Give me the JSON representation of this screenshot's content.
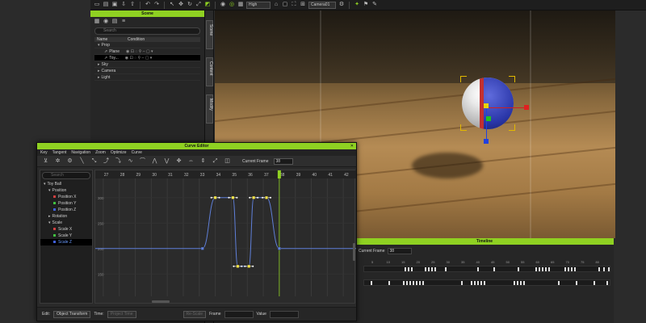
{
  "toolbar": {
    "quality": "High",
    "camera": "Camera01",
    "icons": [
      "new-file-icon",
      "open-folder-icon",
      "save-icon",
      "import-icon",
      "export-icon",
      "undo-icon",
      "redo-icon",
      "select-icon",
      "move-icon",
      "rotate-icon",
      "scale-icon",
      "snap-icon",
      "camera-icon",
      "eye-icon",
      "render-icon",
      "home-icon",
      "view-icon",
      "fullscreen-icon",
      "grid-icon",
      "settings-icon"
    ]
  },
  "scene": {
    "title": "Scene",
    "search_placeholder": "Search",
    "col_name": "Name",
    "col_condition": "Condition",
    "items": [
      {
        "label": "Prop",
        "indent": 0,
        "twisty": "▾"
      },
      {
        "label": "Plane",
        "indent": 1,
        "twisty": ""
      },
      {
        "label": "Toy...",
        "indent": 1,
        "twisty": "",
        "selected": true
      },
      {
        "label": "Sky",
        "indent": 0,
        "twisty": "▸"
      },
      {
        "label": "Camera",
        "indent": 0,
        "twisty": "▸"
      },
      {
        "label": "Light",
        "indent": 0,
        "twisty": "▸"
      }
    ],
    "side_tabs": [
      "Scene",
      "Content",
      "Modify"
    ]
  },
  "curve_editor": {
    "title": "Curve Editor",
    "menu": [
      "Key",
      "Tangent",
      "Navigation",
      "Zoom",
      "Optimize",
      "Curve"
    ],
    "current_frame_label": "Current Frame",
    "current_frame": "38",
    "search_placeholder": "Search",
    "tree": [
      {
        "label": "Toy Ball",
        "level": 0,
        "twisty": "▾"
      },
      {
        "label": "Position",
        "level": 1,
        "twisty": "▾"
      },
      {
        "label": "Position X",
        "level": 2,
        "color": "#d04040"
      },
      {
        "label": "Position Y",
        "level": 2,
        "color": "#40c040"
      },
      {
        "label": "Position Z",
        "level": 2,
        "color": "#4060e0"
      },
      {
        "label": "Rotation",
        "level": 1,
        "twisty": "▸"
      },
      {
        "label": "Scale",
        "level": 1,
        "twisty": "▾"
      },
      {
        "label": "Scale X",
        "level": 2,
        "color": "#d04040"
      },
      {
        "label": "Scale Y",
        "level": 2,
        "color": "#40c040"
      },
      {
        "label": "Scale Z",
        "level": 2,
        "color": "#4060e0",
        "selected": true
      }
    ],
    "frame_ticks": [
      "27",
      "28",
      "29",
      "30",
      "31",
      "32",
      "33",
      "34",
      "35",
      "36",
      "37",
      "38",
      "39",
      "40",
      "41",
      "42"
    ],
    "value_ticks": [
      "300",
      "250",
      "200",
      "150"
    ],
    "curve_keys": [
      {
        "frame": 33.2,
        "value": 200
      },
      {
        "frame": 34.0,
        "value": 300
      },
      {
        "frame": 35.1,
        "value": 300
      },
      {
        "frame": 35.4,
        "value": 165
      },
      {
        "frame": 36.1,
        "value": 165
      },
      {
        "frame": 36.4,
        "value": 300
      },
      {
        "frame": 37.2,
        "value": 300
      },
      {
        "frame": 38.0,
        "value": 200
      }
    ],
    "bottom": {
      "edit_label": "Edit:",
      "edit_value": "Object Transform",
      "time_label": "Time:",
      "time_value": "Project Time",
      "re_scale": "Re-Scale",
      "frame_label": "Frame",
      "value_label": "Value"
    }
  },
  "timeline": {
    "title": "Timeline",
    "frame_label": "Current Frame",
    "frame_value": "38",
    "ticks": [
      "5",
      "10",
      "15",
      "20",
      "25",
      "30",
      "35",
      "40",
      "45",
      "50",
      "55",
      "60",
      "65",
      "70",
      "75",
      "80"
    ]
  },
  "colors": {
    "accent": "#8fd122",
    "curve": "#5f7fd8",
    "key": "#ffffff",
    "playhead": "#8fd122"
  }
}
